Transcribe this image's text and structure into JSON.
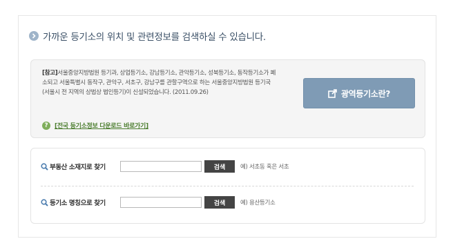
{
  "heading": "가까운 등기소의 위치 및 관련정보를 검색하실 수 있습니다.",
  "notice": {
    "tag": "[참고]",
    "body": "서울중앙지방법원 등기과, 상업등기소, 강남등기소, 관악등기소, 성북등기소, 동작등기소가 폐소되고 서울특별시 동작구, 관악구, 서초구, 강남구를 관할구역으로 하는 서울중앙지방법원 등기국(서울시 전 지역의 상법상 법인등기)이 신설되었습니다. (2011.09.26)",
    "help_link": "[전국 등기소정보 다운로드 바로가기]",
    "region_button": "광역등기소란?"
  },
  "search": {
    "address": {
      "label": "부동산 소재지로 찾기",
      "value": "",
      "button": "검색",
      "example": "예) 서초동 혹은 서초"
    },
    "office": {
      "label": "등기소 명칭으로 찾기",
      "value": "",
      "button": "검색",
      "example": "예) 용산등기소"
    }
  },
  "colors": {
    "accent": "#7f9bb5",
    "heading": "#3a4f66",
    "help": "#7fae5b",
    "search_button": "#444444"
  }
}
